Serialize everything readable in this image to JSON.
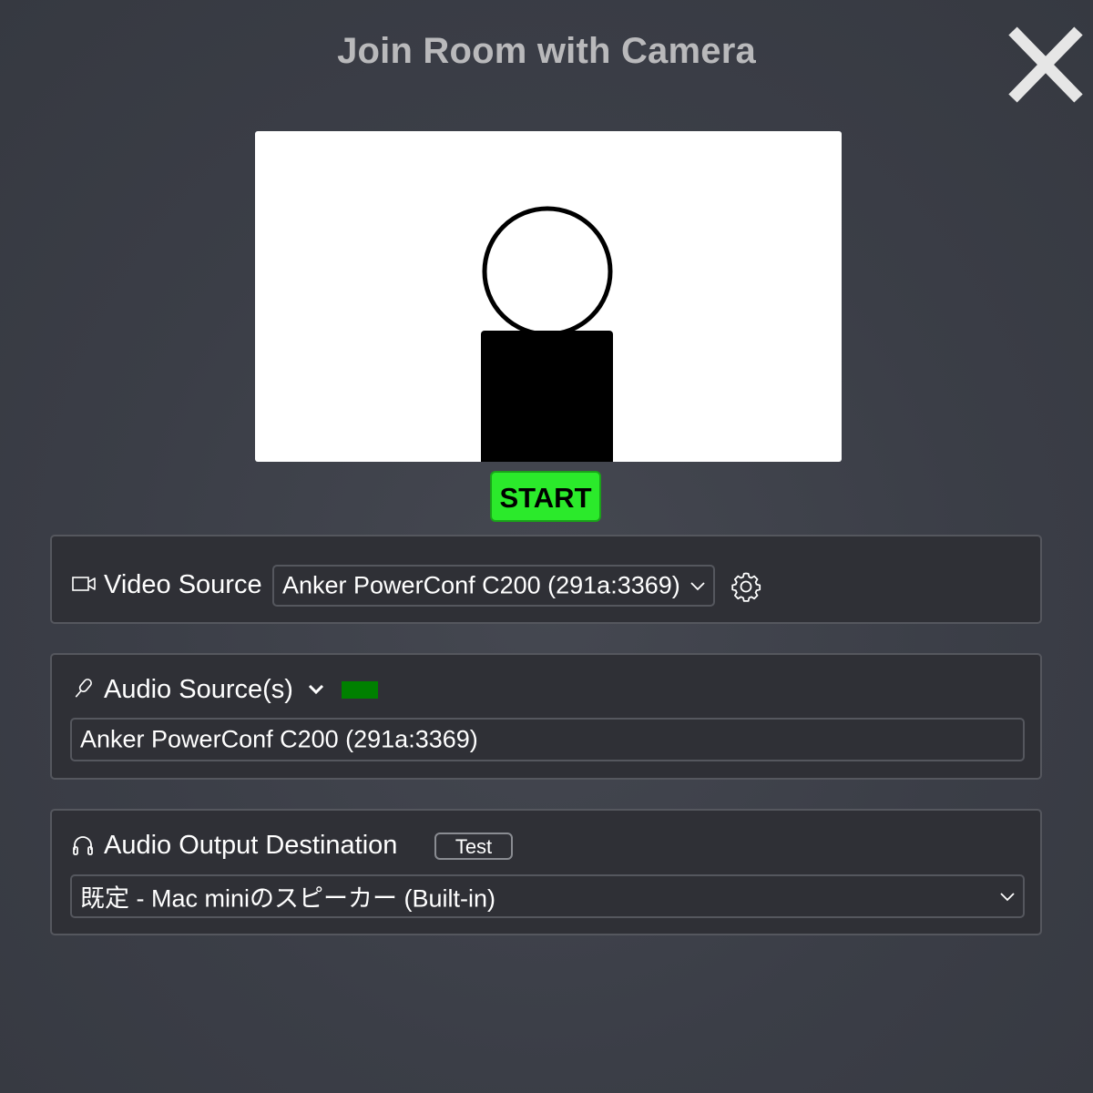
{
  "dialog": {
    "title": "Join Room with Camera"
  },
  "preview": {
    "start_label": "START"
  },
  "video": {
    "label": "Video Source",
    "selected": "Anker PowerConf C200 (291a:3369)",
    "icon": "video-camera-icon",
    "settings_icon": "gear-icon"
  },
  "audio": {
    "label": "Audio Source(s)",
    "selected": "Anker PowerConf C200 (291a:3369)",
    "icon": "microphone-icon",
    "level_color": "#008000"
  },
  "output": {
    "label": "Audio Output Destination",
    "test_label": "Test",
    "selected": "既定 - Mac miniのスピーカー (Built-in)",
    "icon": "headphones-icon"
  },
  "colors": {
    "background": "#3a3d46",
    "panel": "#2f3036",
    "start_button": "#2bea2b",
    "title": "#b9b9bb"
  }
}
